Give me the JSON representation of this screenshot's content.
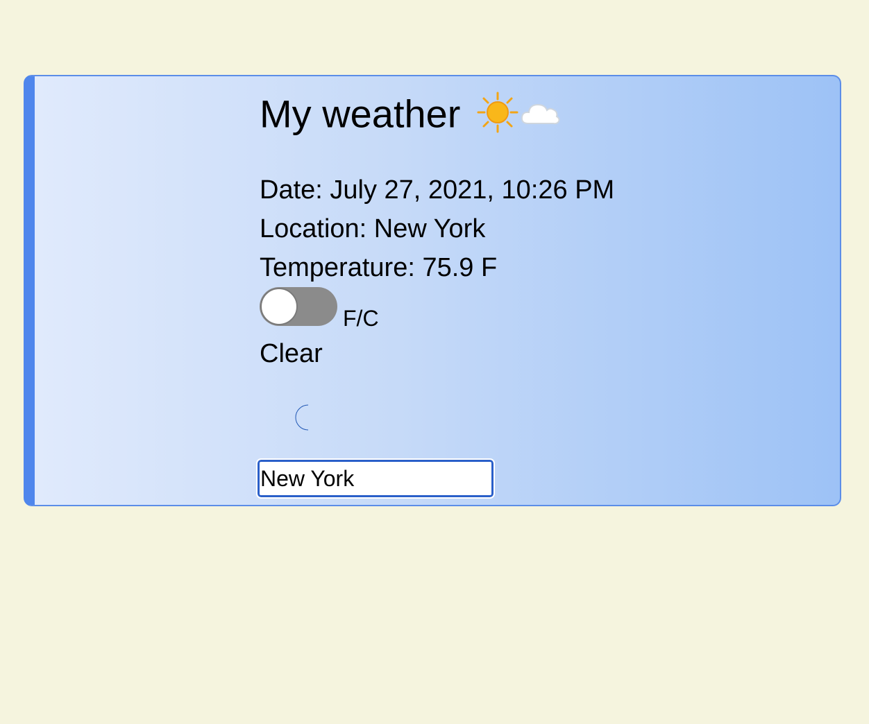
{
  "app": {
    "title": "My weather",
    "title_icons": [
      "sun-icon",
      "cloud-icon"
    ]
  },
  "weather": {
    "date_line": "Date: July 27, 2021, 10:26 PM",
    "location_line": "Location: New York",
    "temperature_line": "Temperature: 75.9 F",
    "unit_toggle_label": "F/C",
    "unit_toggle_state": "F",
    "condition": "Clear",
    "condition_icon": "crescent-moon-icon"
  },
  "search": {
    "value": "New York"
  },
  "colors": {
    "page_background": "#f5f4de",
    "card_accent": "#4f86ec",
    "toggle_track": "#8b8b8b",
    "moon": "#2f6fd6"
  }
}
